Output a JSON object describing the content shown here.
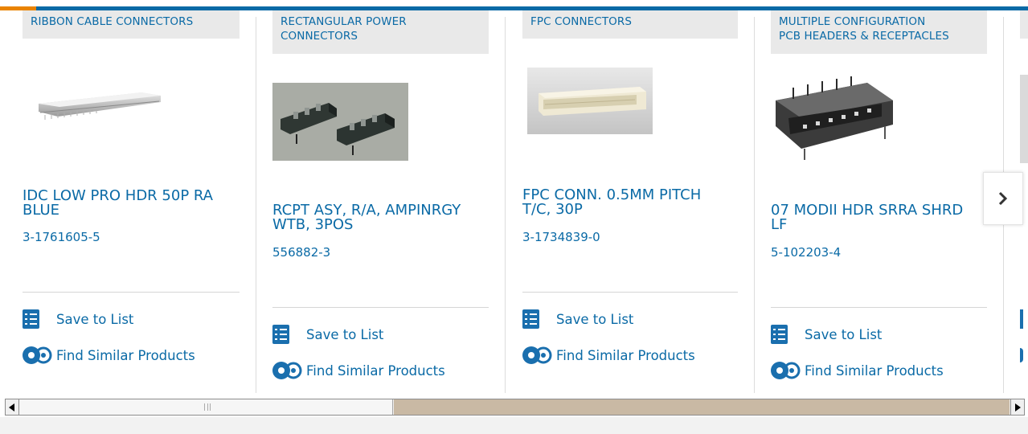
{
  "colors": {
    "brand_blue": "#0a6aa6",
    "accent_orange": "#e98300",
    "category_bg": "#e9e9e9"
  },
  "cards": [
    {
      "category": "RIBBON CABLE CONNECTORS",
      "title": "IDC LOW PRO HDR 50P RA\nBLUE",
      "part_number": "3-1761605-5",
      "save_label": "Save to List",
      "similar_label": "Find Similar Products",
      "image_icon": "idc-header-image"
    },
    {
      "category": "RECTANGULAR POWER\nCONNECTORS",
      "title": "RCPT ASY, R/A, AMPINRGY\nWTB, 3POS",
      "part_number": "556882-3",
      "save_label": "Save to List",
      "similar_label": "Find Similar Products",
      "image_icon": "power-connector-image"
    },
    {
      "category": "FPC CONNECTORS",
      "title": "FPC CONN. 0.5MM PITCH\nT/C, 30P",
      "part_number": "3-1734839-0",
      "save_label": "Save to List",
      "similar_label": "Find Similar Products",
      "image_icon": "fpc-connector-image"
    },
    {
      "category": "MULTIPLE CONFIGURATION\nPCB HEADERS & RECEPTACLES",
      "title": "07 MODII HDR SRRA SHRD\nLF",
      "part_number": "5-102203-4",
      "save_label": "Save to List",
      "similar_label": "Find Similar Products",
      "image_icon": "pcb-header-image"
    }
  ],
  "carousel": {
    "next_icon": "chevron-right-icon"
  },
  "scrollbar": {
    "left_icon": "triangle-left-icon",
    "right_icon": "triangle-right-icon",
    "position_fraction": 0.38
  }
}
